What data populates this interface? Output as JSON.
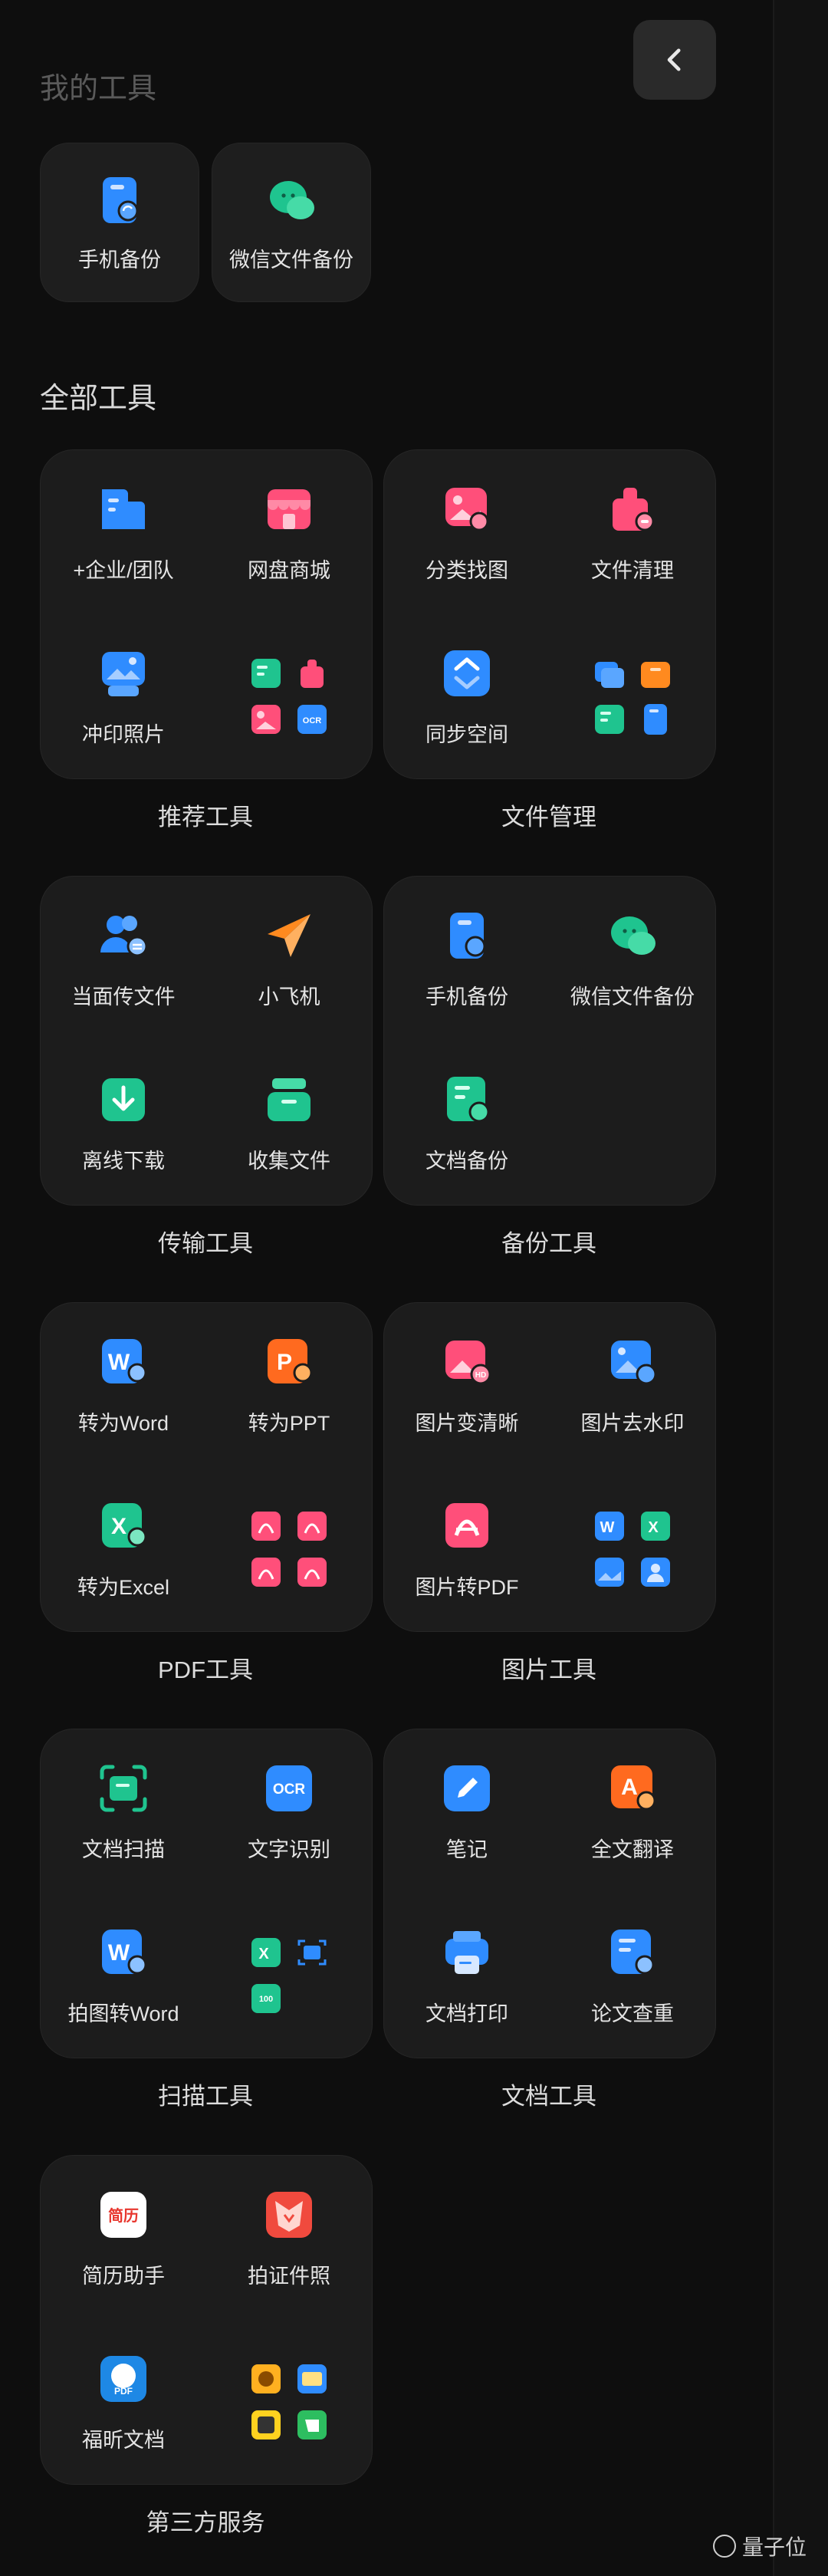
{
  "header": {
    "my_tools_title": "我的工具",
    "all_tools_title": "全部工具"
  },
  "my_tools": [
    {
      "label": "手机备份",
      "icon": "phone-backup-icon"
    },
    {
      "label": "微信文件备份",
      "icon": "wechat-backup-icon"
    }
  ],
  "groups": [
    {
      "title": "推荐工具",
      "items": [
        {
          "label": "+企业/团队"
        },
        {
          "label": "网盘商城"
        },
        {
          "label": "冲印照片"
        }
      ]
    },
    {
      "title": "文件管理",
      "items": [
        {
          "label": "分类找图"
        },
        {
          "label": "文件清理"
        },
        {
          "label": "同步空间"
        }
      ]
    },
    {
      "title": "传输工具",
      "items": [
        {
          "label": "当面传文件"
        },
        {
          "label": "小飞机"
        },
        {
          "label": "离线下载"
        },
        {
          "label": "收集文件"
        }
      ]
    },
    {
      "title": "备份工具",
      "items": [
        {
          "label": "手机备份"
        },
        {
          "label": "微信文件备份"
        },
        {
          "label": "文档备份"
        }
      ]
    },
    {
      "title": "PDF工具",
      "items": [
        {
          "label": "转为Word"
        },
        {
          "label": "转为PPT"
        },
        {
          "label": "转为Excel"
        }
      ]
    },
    {
      "title": "图片工具",
      "items": [
        {
          "label": "图片变清晰"
        },
        {
          "label": "图片去水印"
        },
        {
          "label": "图片转PDF"
        }
      ]
    },
    {
      "title": "扫描工具",
      "items": [
        {
          "label": "文档扫描"
        },
        {
          "label": "文字识别"
        },
        {
          "label": "拍图转Word"
        }
      ]
    },
    {
      "title": "文档工具",
      "items": [
        {
          "label": "笔记"
        },
        {
          "label": "全文翻译"
        },
        {
          "label": "文档打印"
        },
        {
          "label": "论文查重"
        }
      ]
    },
    {
      "title": "第三方服务",
      "items": [
        {
          "label": "简历助手"
        },
        {
          "label": "拍证件照"
        },
        {
          "label": "福昕文档"
        }
      ]
    }
  ],
  "icon_text": {
    "ocr": "OCR",
    "word": "W",
    "ppt": "P",
    "excel": "X",
    "translate": "A",
    "resume": "简历",
    "pdf": "PDF",
    "hd": "HD",
    "one_hundred": "100"
  },
  "watermark": "量子位"
}
